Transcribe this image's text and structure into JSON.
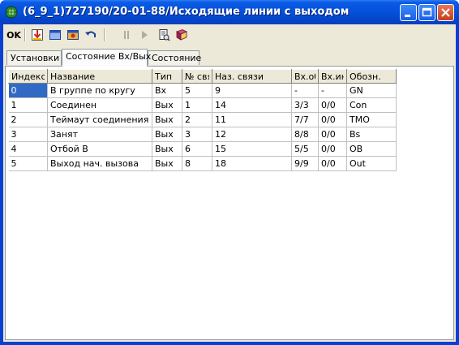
{
  "window": {
    "title": "(6_9_1)727190/20-01-88/Исходящие линии с выходом"
  },
  "toolbar": {
    "ok_label": "OK"
  },
  "tabs": [
    {
      "label": "Установки"
    },
    {
      "label": "Состояние Вх/Вых"
    },
    {
      "label": "Состояние"
    }
  ],
  "grid": {
    "headers": [
      "Индекс",
      "Название",
      "Тип",
      "№ свя",
      "Наз. связи",
      "Вх.об",
      "Вх.ин",
      "Обозн."
    ],
    "rows": [
      [
        "0",
        "В группе по кругу",
        "Вх",
        "5",
        "9",
        "-",
        "-",
        "GN"
      ],
      [
        "1",
        "Соединен",
        "Вых",
        "1",
        "14",
        "3/3",
        "0/0",
        "Con"
      ],
      [
        "2",
        "Теймаут соединения",
        "Вых",
        "2",
        "11",
        "7/7",
        "0/0",
        "TMO"
      ],
      [
        "3",
        "Занят",
        "Вых",
        "3",
        "12",
        "8/8",
        "0/0",
        "Bs"
      ],
      [
        "4",
        "Отбой В",
        "Вых",
        "6",
        "15",
        "5/5",
        "0/0",
        "OB"
      ],
      [
        "5",
        "Выход нач. вызова",
        "Вых",
        "8",
        "18",
        "9/9",
        "0/0",
        "Out"
      ]
    ]
  },
  "colors": {
    "titlebar": "#0552dc",
    "selection": "#316ac5",
    "face": "#ece9d8"
  }
}
